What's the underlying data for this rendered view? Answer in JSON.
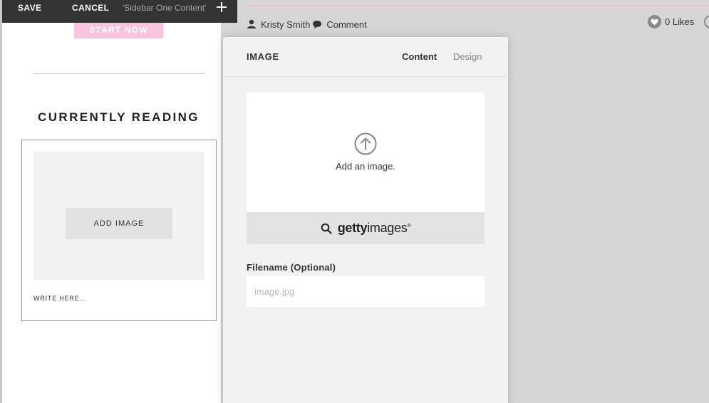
{
  "toolbar": {
    "save_label": "SAVE",
    "cancel_label": "CANCEL",
    "title": "'Sidebar One Content'",
    "add_icon": "plus-icon"
  },
  "post": {
    "author": "Kristy Smith",
    "comment_label": "Comment",
    "likes_label": "0 Likes"
  },
  "sidebar": {
    "start_button_label": "START NOW",
    "section_title": "CURRENTLY READING",
    "add_image_label": "ADD IMAGE",
    "write_here": "WRITE HERE..."
  },
  "panel": {
    "title": "IMAGE",
    "tabs": [
      {
        "label": "Content",
        "active": true
      },
      {
        "label": "Design",
        "active": false
      }
    ],
    "add_image_text": "Add an image.",
    "getty_bold": "getty",
    "getty_rest": "images",
    "getty_mark": "®",
    "filename_label": "Filename (Optional)",
    "filename_placeholder": "image.jpg",
    "filename_value": ""
  },
  "colors": {
    "toolbar_bg": "#333333",
    "accent_pink": "#f9c5dc",
    "panel_bg": "#f2f2f2",
    "page_bg": "#d6d6d6"
  }
}
